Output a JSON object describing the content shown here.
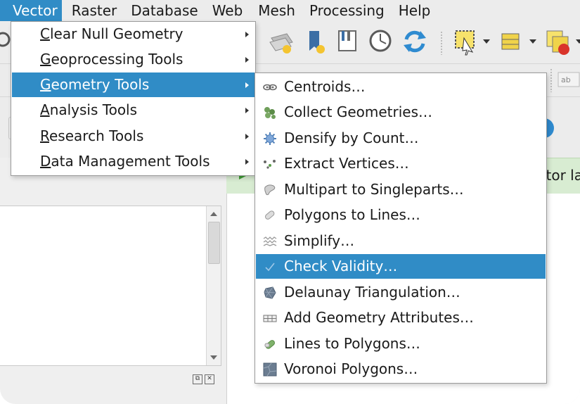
{
  "menubar": {
    "items": [
      {
        "label": "Vector",
        "active": true
      },
      {
        "label": "Raster"
      },
      {
        "label": "Database"
      },
      {
        "label": "Web"
      },
      {
        "label": "Mesh"
      },
      {
        "label": "Processing"
      },
      {
        "label": "Help"
      }
    ]
  },
  "vector_menu": {
    "items": [
      {
        "label": "Clear Null Geometry"
      },
      {
        "label": "Geoprocessing Tools"
      },
      {
        "label": "Geometry Tools",
        "highlighted": true
      },
      {
        "label": "Analysis Tools"
      },
      {
        "label": "Research Tools"
      },
      {
        "label": "Data Management Tools"
      }
    ]
  },
  "geometry_menu": {
    "items": [
      {
        "label": "Centroids…",
        "icon": "centroids-icon"
      },
      {
        "label": "Collect Geometries…",
        "icon": "collect-geometries-icon"
      },
      {
        "label": "Densify by Count…",
        "icon": "densify-icon"
      },
      {
        "label": "Extract Vertices…",
        "icon": "extract-vertices-icon"
      },
      {
        "label": "Multipart to Singleparts…",
        "icon": "multipart-icon"
      },
      {
        "label": "Polygons to Lines…",
        "icon": "polygons-to-lines-icon"
      },
      {
        "label": "Simplify…",
        "icon": "simplify-icon"
      },
      {
        "label": "Check Validity…",
        "icon": "check-validity-icon",
        "highlighted": true
      },
      {
        "label": "Delaunay Triangulation…",
        "icon": "delaunay-icon"
      },
      {
        "label": "Add Geometry Attributes…",
        "icon": "add-geometry-attributes-icon"
      },
      {
        "label": "Lines to Polygons…",
        "icon": "lines-to-polygons-icon"
      },
      {
        "label": "Voronoi Polygons…",
        "icon": "voronoi-icon"
      }
    ]
  },
  "message_bar": {
    "text": "tor la"
  },
  "colors": {
    "highlight": "#308cc6",
    "menubar_bg": "#ececec",
    "message_bar_bg": "#d8ecd2"
  }
}
